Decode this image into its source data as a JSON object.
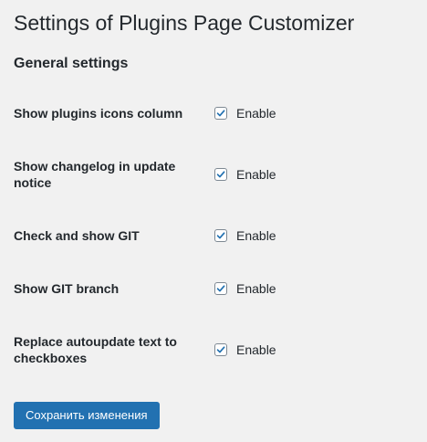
{
  "page": {
    "title": "Settings of Plugins Page Customizer",
    "section_title": "General settings"
  },
  "settings": [
    {
      "label": "Show plugins icons column",
      "control_label": "Enable",
      "checked": true
    },
    {
      "label": "Show changelog in update notice",
      "control_label": "Enable",
      "checked": true
    },
    {
      "label": "Check and show GIT",
      "control_label": "Enable",
      "checked": true
    },
    {
      "label": "Show GIT branch",
      "control_label": "Enable",
      "checked": true
    },
    {
      "label": "Replace autoupdate text to checkboxes",
      "control_label": "Enable",
      "checked": true
    }
  ],
  "actions": {
    "save_label": "Сохранить изменения"
  },
  "colors": {
    "background": "#f1f1f1",
    "primary_button": "#2271b1",
    "checkmark": "#2271b1",
    "text": "#23282d"
  },
  "icons": {
    "checkbox_checked": "checkmark-icon"
  }
}
